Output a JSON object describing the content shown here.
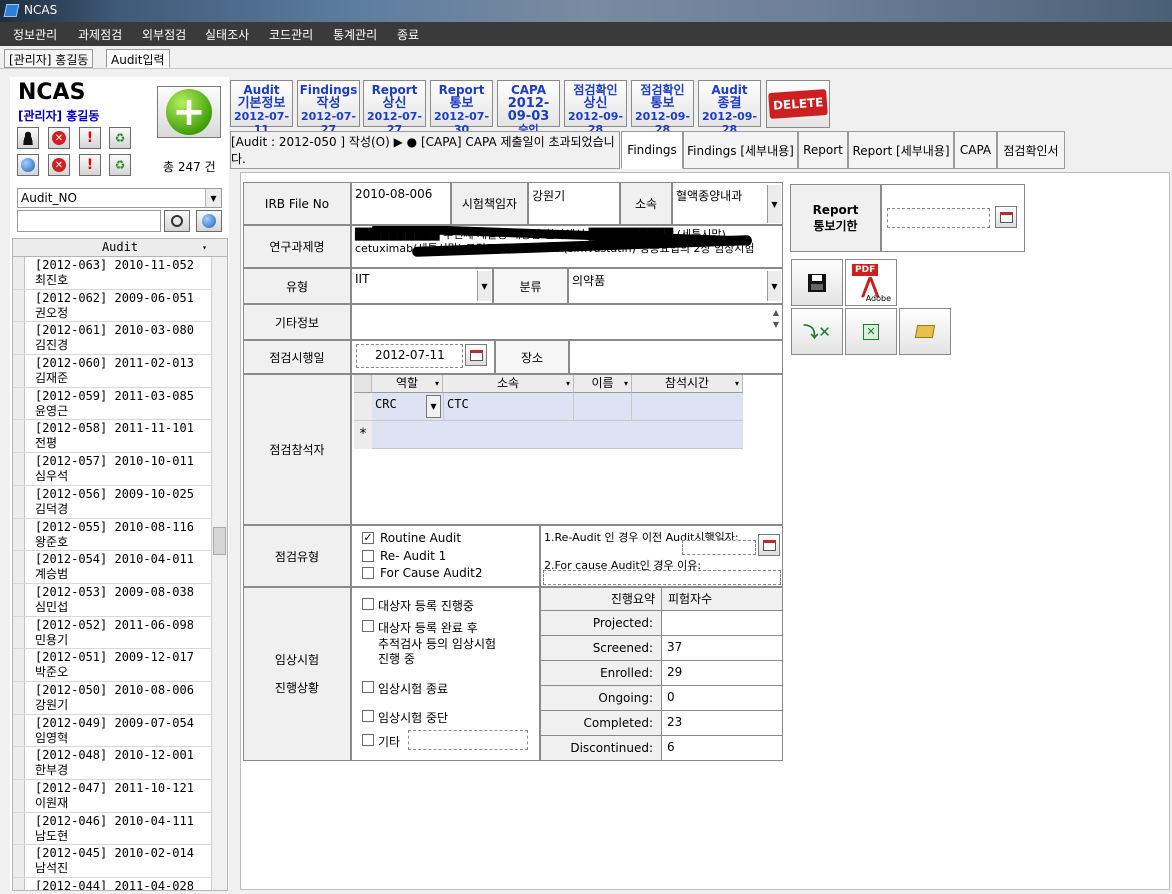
{
  "window": {
    "title": "NCAS"
  },
  "menu": [
    "정보관리",
    "과제점검",
    "외부점검",
    "실태조사",
    "코드관리",
    "통계관리",
    "종료"
  ],
  "user_tabs": [
    "[관리자] 홍길동",
    "Audit입력"
  ],
  "left": {
    "logo": "NCAS",
    "admin": "[관리자] 홍길동",
    "total": "총 247 건",
    "search_field": "Audit_NO",
    "search_value": "",
    "list_header": "Audit",
    "list": [
      {
        "line1": "[2012-063] 2010-11-052",
        "line2": "최진호"
      },
      {
        "line1": "[2012-062] 2009-06-051",
        "line2": "권오정"
      },
      {
        "line1": "[2012-061] 2010-03-080",
        "line2": "김진경"
      },
      {
        "line1": "[2012-060] 2011-02-013",
        "line2": "김재준"
      },
      {
        "line1": "[2012-059] 2011-03-085",
        "line2": "윤영근"
      },
      {
        "line1": "[2012-058] 2011-11-101",
        "line2": "전평"
      },
      {
        "line1": "[2012-057] 2010-10-011",
        "line2": "심우석"
      },
      {
        "line1": "[2012-056] 2009-10-025",
        "line2": "김덕경"
      },
      {
        "line1": "[2012-055] 2010-08-116",
        "line2": "왕준호"
      },
      {
        "line1": "[2012-054] 2010-04-011",
        "line2": "계승범"
      },
      {
        "line1": "[2012-053] 2009-08-038",
        "line2": "심민섭"
      },
      {
        "line1": "[2012-052] 2011-06-098",
        "line2": "민용기"
      },
      {
        "line1": "[2012-051] 2009-12-017",
        "line2": "박준오"
      },
      {
        "line1": "[2012-050] 2010-08-006",
        "line2": "강원기"
      },
      {
        "line1": "[2012-049] 2009-07-054",
        "line2": "임영혁"
      },
      {
        "line1": "[2012-048] 2010-12-001",
        "line2": "한부경"
      },
      {
        "line1": "[2012-047] 2011-10-121",
        "line2": "이원재"
      },
      {
        "line1": "[2012-046] 2010-04-111",
        "line2": "남도현"
      },
      {
        "line1": "[2012-045] 2010-02-014",
        "line2": "남석진"
      },
      {
        "line1": "[2012-044] 2011-04-028",
        "line2": ""
      }
    ]
  },
  "actions": [
    {
      "l1": "Audit",
      "l2": "기본정보",
      "date": "2012-07-11"
    },
    {
      "l1": "Findings",
      "l2": "작성",
      "date": "2012-07-27"
    },
    {
      "l1": "Report",
      "l2": "상신",
      "date": "2012-07-27"
    },
    {
      "l1": "Report",
      "l2": "통보",
      "date": "2012-07-30"
    },
    {
      "l1": "CAPA",
      "l2": "2012-09-03",
      "date": "승인"
    },
    {
      "l1": "점검확인",
      "l2": "상신",
      "date": "2012-09-28"
    },
    {
      "l1": "점검확인",
      "l2": "통보",
      "date": "2012-09-28"
    },
    {
      "l1": "Audit",
      "l2": "종결",
      "date": "2012-09-28"
    }
  ],
  "delete_label": "DELETE",
  "status_tab": "[Audit : 2012-050 ] 작성(O) ▶ ● [CAPA] CAPA 제출일이 초과되었습니다.",
  "tabs": [
    "Findings",
    "Findings [세부내용]",
    "Report",
    "Report [세부내용]",
    "CAPA",
    "점검확인서"
  ],
  "form": {
    "irb_label": "IRB File No",
    "irb_value": "2010-08-006",
    "pi_label": "시험책임자",
    "pi_value": "강원기",
    "dept_label": "소속",
    "dept_value": "혈액종양내과",
    "title_label": "연구과제명",
    "title_value": "██████████ 두번째 재발성 대장암 환자에서 ██████████ (세툭시맙) cetuximab(세툭시맙) 그리고 simvastatin(simvastatin) 병용요법의 2상 임상시험",
    "type_label": "유형",
    "type_value": "IIT",
    "class_label": "분류",
    "class_value": "의약품",
    "etc_label": "기타정보",
    "etc_value": "",
    "date_label": "점검시행일",
    "date_value": "2012-07-11",
    "place_label": "장소",
    "place_value": "",
    "participants_label": "점검참석자",
    "grid_headers": [
      "역할",
      "소속",
      "이름",
      "참석시간"
    ],
    "grid_rows": [
      {
        "role": "CRC",
        "dept": "CTC",
        "name": "",
        "time": ""
      }
    ],
    "new_row_marker": "*",
    "audit_type_label": "점검유형",
    "audit_types": [
      {
        "label": "Routine Audit",
        "checked": true
      },
      {
        "label": "Re- Audit 1",
        "checked": false
      },
      {
        "label": "For Cause Audit2",
        "checked": false
      }
    ],
    "reaudit_note": "1.Re-Audit 인 경우 이전 Audit시행일자:",
    "cause_note": "2.For cause Audit인 경우 이유:",
    "progress_label_1": "임상시험",
    "progress_label_2": "진행상황",
    "progress_opts": [
      {
        "label": "대상자 등록 진행중"
      },
      {
        "label": "대상자 등록 완료 후"
      },
      {
        "label": "임상시험 종료"
      },
      {
        "label": "임상시험 중단"
      },
      {
        "label": "기타"
      }
    ],
    "progress_sub": [
      "추적검사 등의 임상시험",
      "진행 중"
    ],
    "summary_headers": [
      "진행요약",
      "피험자수"
    ],
    "summary": [
      {
        "k": "Projected:",
        "v": ""
      },
      {
        "k": "Screened:",
        "v": "37"
      },
      {
        "k": "Enrolled:",
        "v": "29"
      },
      {
        "k": "Ongoing:",
        "v": "0"
      },
      {
        "k": "Completed:",
        "v": "23"
      },
      {
        "k": "Discontinued:",
        "v": "6"
      }
    ]
  },
  "report": {
    "label1": "Report",
    "label2": "통보기한",
    "value": ""
  },
  "tool_buttons": {
    "save": "save",
    "pdf": "PDF",
    "pdf_brand": "Adobe"
  }
}
